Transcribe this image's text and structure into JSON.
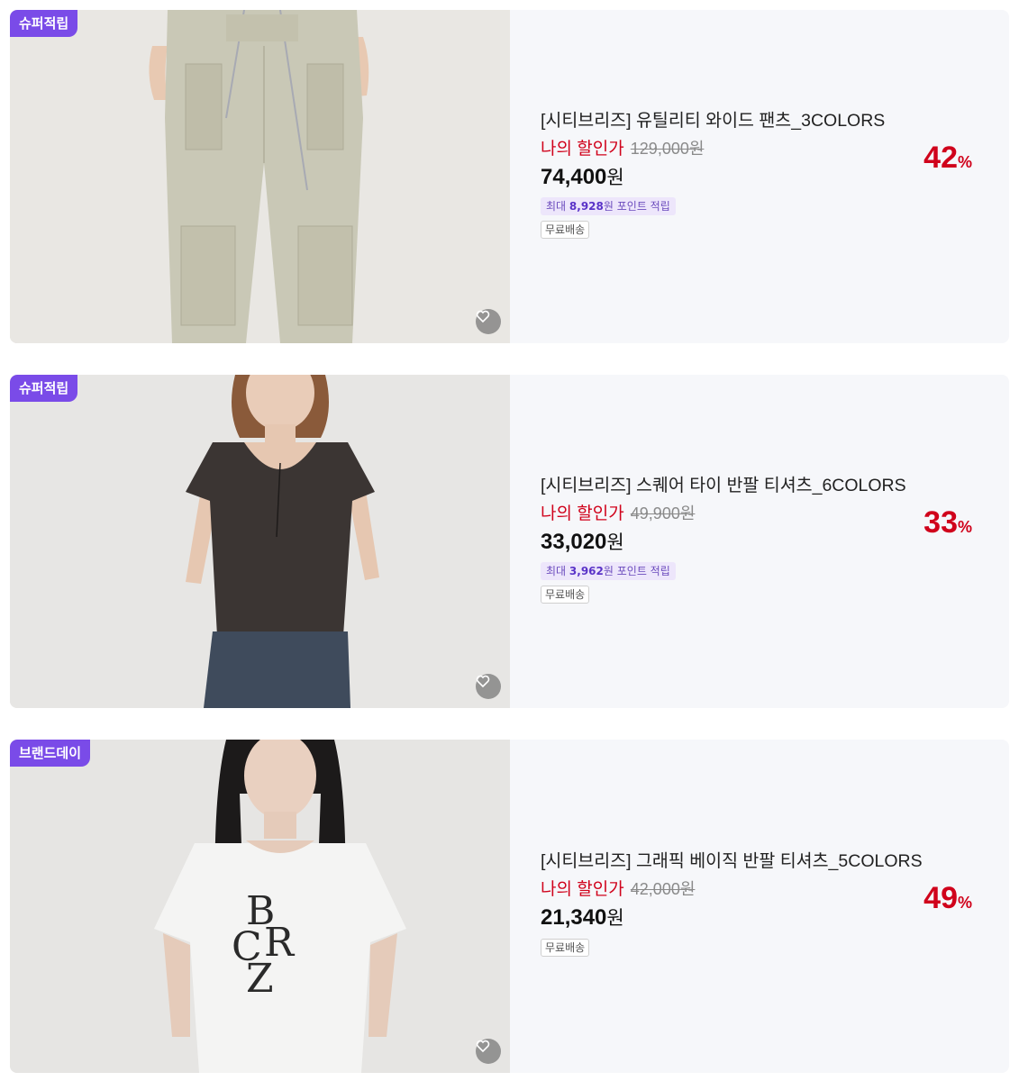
{
  "products": [
    {
      "badge": "슈퍼적립",
      "image": "pants-photo",
      "title": "[시티브리즈] 유틸리티 와이드 팬츠_3COLORS",
      "my_price_label": "나의 할인가",
      "original_price": "129,000원",
      "final_price": "74,400",
      "currency": "원",
      "discount": "42",
      "discount_unit": "%",
      "point_prefix": "최대",
      "point_amount": "8,928",
      "point_suffix": "원 포인트 적립",
      "shipping": "무료배송"
    },
    {
      "badge": "슈퍼적립",
      "image": "tee-photo",
      "title": "[시티브리즈] 스퀘어 타이 반팔 티셔츠_6COLORS",
      "my_price_label": "나의 할인가",
      "original_price": "49,900원",
      "final_price": "33,020",
      "currency": "원",
      "discount": "33",
      "discount_unit": "%",
      "point_prefix": "최대",
      "point_amount": "3,962",
      "point_suffix": "원 포인트 적립",
      "shipping": "무료배송"
    },
    {
      "badge": "브랜드데이",
      "image": "graphic-tee-photo",
      "title": "[시티브리즈] 그래픽 베이직 반팔 티셔츠_5COLORS",
      "my_price_label": "나의 할인가",
      "original_price": "42,000원",
      "final_price": "21,340",
      "currency": "원",
      "discount": "49",
      "discount_unit": "%",
      "shipping": "무료배송"
    }
  ],
  "icons": {
    "like": "heart-icon"
  },
  "colors": {
    "badge": "#7a4be8",
    "discount": "#d0021b",
    "point_chip_bg": "#ede6fb",
    "card_bg": "#f6f7fa"
  }
}
